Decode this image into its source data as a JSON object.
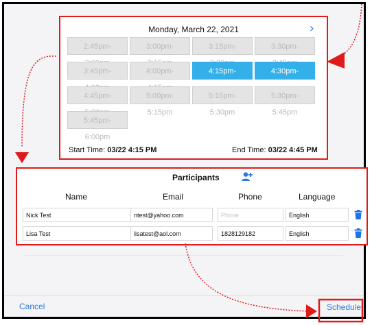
{
  "calendar": {
    "date": "Monday, March 22, 2021",
    "next_icon": "chevron-right-icon",
    "slots": [
      {
        "label": "2:45pm-3:00pm",
        "state": "disabled"
      },
      {
        "label": "3:00pm-3:15pm",
        "state": "disabled"
      },
      {
        "label": "3:15pm-3:30pm",
        "state": "disabled"
      },
      {
        "label": "3:30pm-3:45pm",
        "state": "disabled"
      },
      {
        "label": "3:45pm-4:00pm",
        "state": "disabled"
      },
      {
        "label": "4:00pm-4:15pm",
        "state": "disabled"
      },
      {
        "label": "4:15pm-4:30pm",
        "state": "selected"
      },
      {
        "label": "4:30pm-4:45pm",
        "state": "selected"
      },
      {
        "label": "4:45pm-5:00pm",
        "state": "disabled"
      },
      {
        "label": "5:00pm-5:15pm",
        "state": "disabled"
      },
      {
        "label": "5:15pm-5:30pm",
        "state": "disabled"
      },
      {
        "label": "5:30pm-5:45pm",
        "state": "disabled"
      },
      {
        "label": "5:45pm-6:00pm",
        "state": "disabled"
      }
    ],
    "start_label": "Start Time:",
    "start_value": "03/22 4:15 PM",
    "end_label": "End Time:",
    "end_value": "03/22 4:45 PM"
  },
  "participants": {
    "title": "Participants",
    "add_icon": "add-user-icon",
    "columns": {
      "name": "Name",
      "email": "Email",
      "phone": "Phone",
      "language": "Language"
    },
    "phone_placeholder": "Phone",
    "rows": [
      {
        "name": "Nick Test",
        "email": "ntest@yahoo.com",
        "phone": "",
        "language": "English"
      },
      {
        "name": "Lisa Test",
        "email": "lisatest@aol.com",
        "phone": "1828129182",
        "language": "English"
      }
    ],
    "delete_icon": "trash-icon"
  },
  "footer": {
    "cancel": "Cancel",
    "schedule": "Schedule"
  },
  "colors": {
    "accent": "#2a7ae2",
    "selected_slot": "#33b0ea",
    "annotation_red": "#e0191a"
  }
}
